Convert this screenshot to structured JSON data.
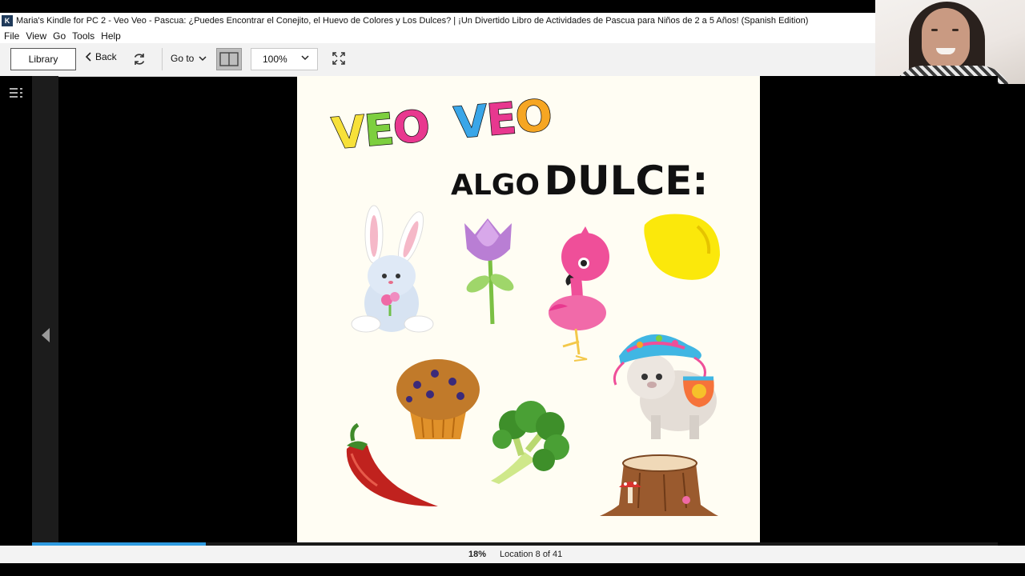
{
  "window": {
    "title": "Maria's Kindle for PC 2 - Veo Veo - Pascua: ¿Puedes Encontrar el Conejito, el Huevo de Colores y Los Dulces? | ¡Un Divertido Libro de Actividades de Pascua para Niños de 2 a 5 Años! (Spanish Edition)"
  },
  "menu": [
    "File",
    "View",
    "Go",
    "Tools",
    "Help"
  ],
  "toolbar": {
    "library_label": "Library",
    "back_label": "Back",
    "goto_label": "Go to",
    "zoom_value": "100%"
  },
  "page": {
    "heading_words": [
      "VEO",
      "VEO"
    ],
    "heading_colors": [
      "#f7e13a",
      "#7dcf3f",
      "#e8388f",
      "#3aa6e8",
      "#e8388f",
      "#f6a623"
    ],
    "subheading_small": "ALGO",
    "subheading_big": "DULCE:",
    "illustrations": [
      "bunny",
      "tulip",
      "flamingo",
      "lemon",
      "llama",
      "muffin",
      "chili-pepper",
      "broccoli",
      "tree-stump"
    ]
  },
  "status": {
    "percent": "18%",
    "location": "Location 8 of 41",
    "progress_fraction": 0.18
  },
  "colors": {
    "progress": "#2e9ae0",
    "page_bg": "#fffdf3"
  }
}
